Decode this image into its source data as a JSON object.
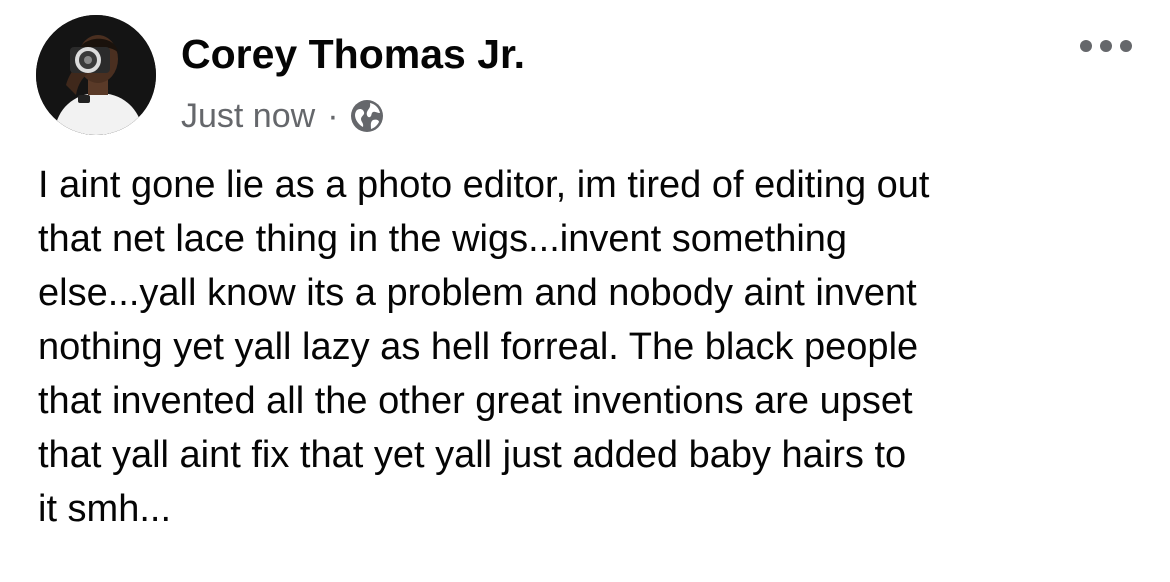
{
  "post": {
    "author": {
      "name": "Corey Thomas Jr.",
      "avatar_icon": "profile-photo-photographer-with-camera"
    },
    "meta": {
      "timestamp": "Just now",
      "separator": "·",
      "audience_icon": "globe-icon"
    },
    "more_options_icon": "ellipsis-icon",
    "body_text": "I aint gone lie as a photo editor, im tired of editing out\nthat net lace thing in the wigs...invent something\nelse...yall know its a problem and nobody aint invent\nnothing yet yall lazy as hell forreal. The black people\nthat invented all the other great inventions are upset\nthat yall aint fix that yet yall just added baby hairs to\nit smh..."
  },
  "colors": {
    "background": "#ffffff",
    "primary_text": "#050505",
    "secondary_text": "#65676b"
  }
}
